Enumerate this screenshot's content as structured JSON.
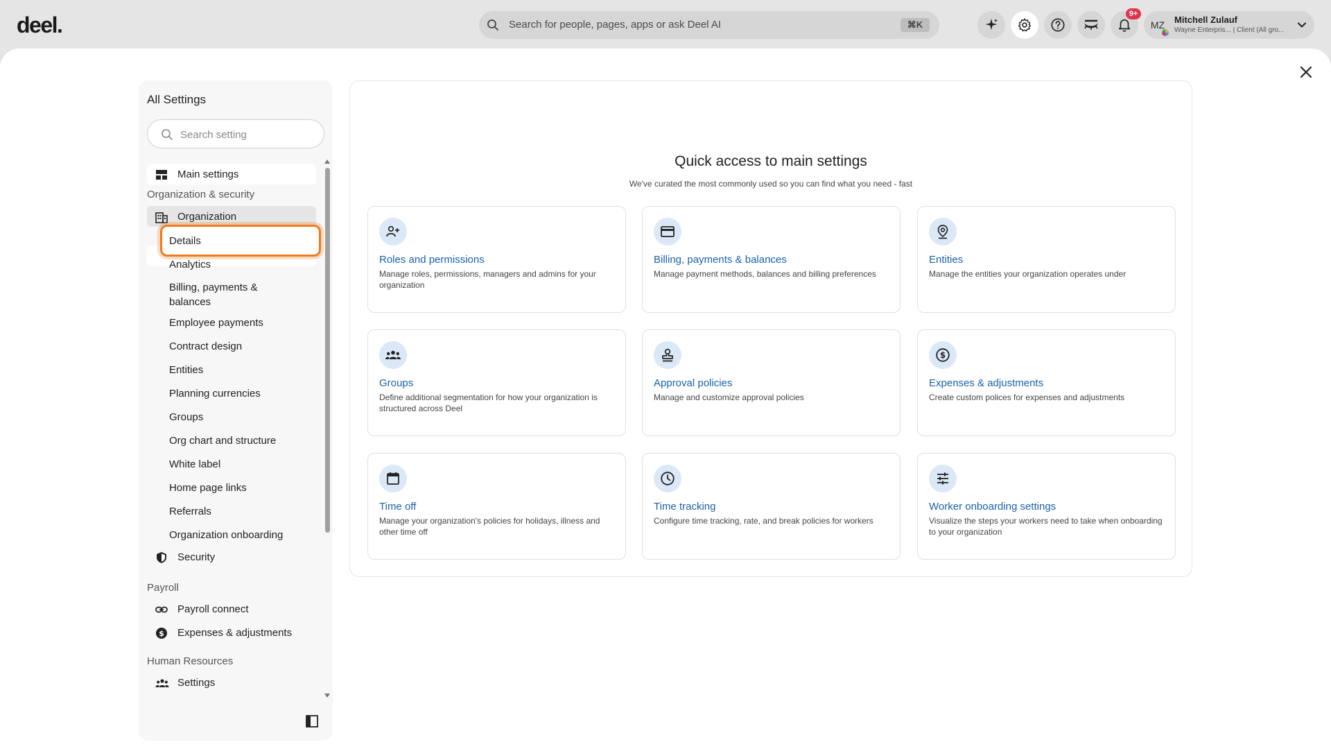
{
  "topbar": {
    "logo": "deel.",
    "search_placeholder": "Search for people, pages, apps or ask Deel AI",
    "search_shortcut": "⌘K",
    "notification_badge": "9+",
    "user": {
      "initials": "MZ",
      "name": "Mitchell Zulauf",
      "subtitle": "Wayne Enterpris... | Client (All gro..."
    }
  },
  "sidebar": {
    "title": "All Settings",
    "search_placeholder": "Search setting",
    "main_settings": "Main settings",
    "section_org": "Organization & security",
    "organization": "Organization",
    "org_subitems": [
      "Details",
      "Analytics",
      "Billing, payments & balances",
      "Employee payments",
      "Contract design",
      "Entities",
      "Planning currencies",
      "Groups",
      "Org chart and structure",
      "White label",
      "Home page links",
      "Referrals",
      "Organization onboarding"
    ],
    "security": "Security",
    "section_payroll": "Payroll",
    "payroll_connect": "Payroll connect",
    "expenses_adjustments": "Expenses & adjustments",
    "section_hr": "Human Resources",
    "hr_settings": "Settings"
  },
  "main": {
    "title": "Quick access to main settings",
    "subtitle": "We've curated the most commonly used so you can find what you need - fast",
    "cards": [
      {
        "icon": "user-plus-icon",
        "title": "Roles and permissions",
        "desc": "Manage roles, permissions, managers and admins for your organization"
      },
      {
        "icon": "credit-card-icon",
        "title": "Billing, payments & balances",
        "desc": "Manage payment methods, balances and billing preferences"
      },
      {
        "icon": "location-pin-icon",
        "title": "Entities",
        "desc": "Manage the entities your organization operates under"
      },
      {
        "icon": "groups-icon",
        "title": "Groups",
        "desc": "Define additional segmentation for how your organization is structured across Deel"
      },
      {
        "icon": "stamp-icon",
        "title": "Approval policies",
        "desc": "Manage and customize approval policies"
      },
      {
        "icon": "dollar-circle-icon",
        "title": "Expenses & adjustments",
        "desc": "Create custom polices for expenses and adjustments"
      },
      {
        "icon": "calendar-icon",
        "title": "Time off",
        "desc": "Manage your organization's policies for holidays, illness and other time off"
      },
      {
        "icon": "clock-icon",
        "title": "Time tracking",
        "desc": "Configure time tracking, rate, and break policies for workers"
      },
      {
        "icon": "sliders-icon",
        "title": "Worker onboarding settings",
        "desc": "Visualize the steps your workers need to take when onboarding to your organization"
      }
    ]
  }
}
